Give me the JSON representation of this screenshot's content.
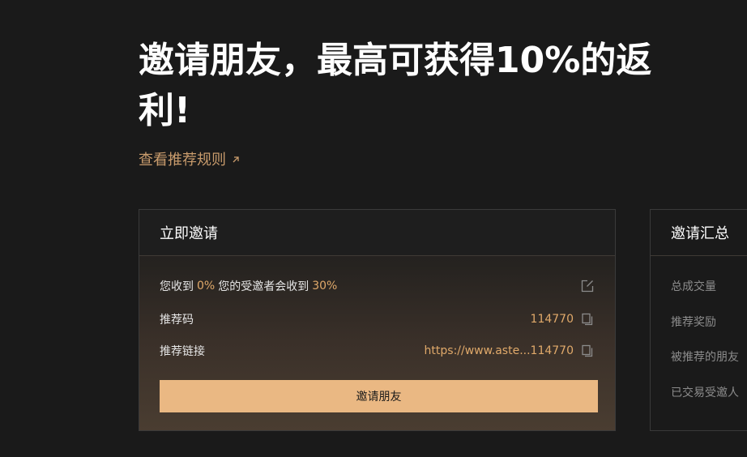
{
  "hero": {
    "title": "邀请朋友，最高可获得10%的返利!",
    "rules_link": "查看推荐规则",
    "rules_link_icon": "arrow-up-right-icon"
  },
  "invite_card": {
    "title": "立即邀请",
    "commission": {
      "you_receive_label": "您收到",
      "you_receive_value": "0%",
      "invitee_receives_label": "您的受邀者会收到",
      "invitee_receives_value": "30%",
      "edit_icon": "edit-icon"
    },
    "referral_code": {
      "label": "推荐码",
      "value": "114770",
      "copy_icon": "copy-icon"
    },
    "referral_link": {
      "label": "推荐链接",
      "value": "https://www.aste...114770",
      "copy_icon": "copy-icon"
    },
    "invite_button": "邀请朋友"
  },
  "summary_card": {
    "title": "邀请汇总",
    "items": [
      "总成交量",
      "推荐奖励",
      "被推荐的朋友",
      "已交易受邀人"
    ]
  },
  "colors": {
    "background": "#1a1a1a",
    "accent": "#e0a96a",
    "link": "#c89b6c",
    "button": "#eab883"
  }
}
